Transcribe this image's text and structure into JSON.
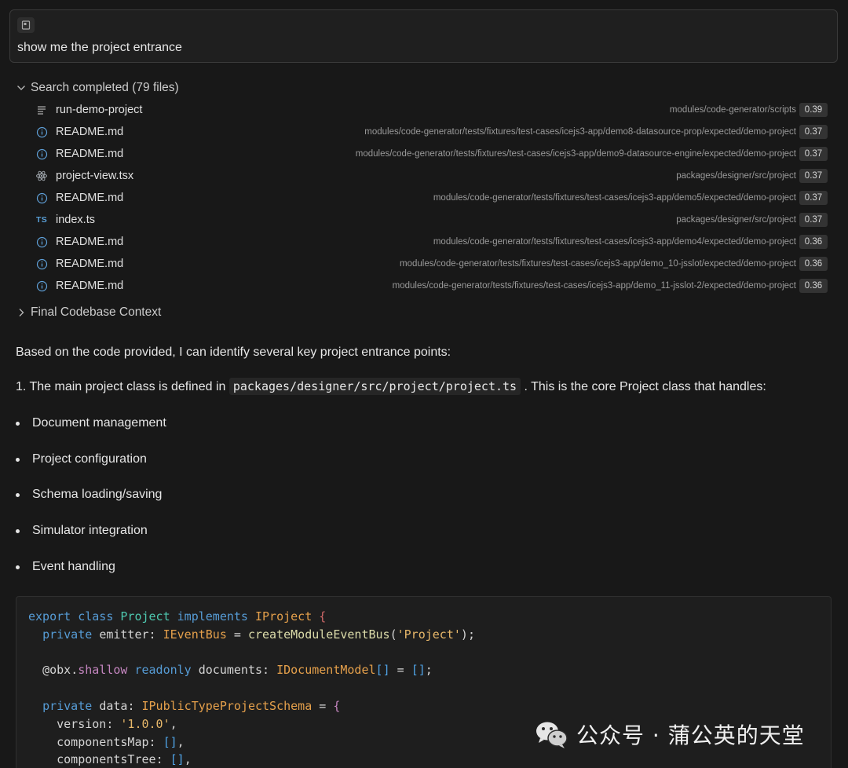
{
  "prompt": {
    "text": "show me the project entrance"
  },
  "search": {
    "header": "Search completed (79 files)",
    "results": [
      {
        "icon": "list-icon",
        "name": "run-demo-project",
        "path": "modules/code-generator/scripts",
        "score": "0.39"
      },
      {
        "icon": "info-icon",
        "name": "README.md",
        "path": "modules/code-generator/tests/fixtures/test-cases/icejs3-app/demo8-datasource-prop/expected/demo-project",
        "score": "0.37"
      },
      {
        "icon": "info-icon",
        "name": "README.md",
        "path": "modules/code-generator/tests/fixtures/test-cases/icejs3-app/demo9-datasource-engine/expected/demo-project",
        "score": "0.37"
      },
      {
        "icon": "react-icon",
        "name": "project-view.tsx",
        "path": "packages/designer/src/project",
        "score": "0.37"
      },
      {
        "icon": "info-icon",
        "name": "README.md",
        "path": "modules/code-generator/tests/fixtures/test-cases/icejs3-app/demo5/expected/demo-project",
        "score": "0.37"
      },
      {
        "icon": "ts-icon",
        "name": "index.ts",
        "path": "packages/designer/src/project",
        "score": "0.37"
      },
      {
        "icon": "info-icon",
        "name": "README.md",
        "path": "modules/code-generator/tests/fixtures/test-cases/icejs3-app/demo4/expected/demo-project",
        "score": "0.36"
      },
      {
        "icon": "info-icon",
        "name": "README.md",
        "path": "modules/code-generator/tests/fixtures/test-cases/icejs3-app/demo_10-jsslot/expected/demo-project",
        "score": "0.36"
      },
      {
        "icon": "info-icon",
        "name": "README.md",
        "path": "modules/code-generator/tests/fixtures/test-cases/icejs3-app/demo_11-jsslot-2/expected/demo-project",
        "score": "0.36"
      }
    ]
  },
  "context": {
    "header": "Final Codebase Context"
  },
  "answer": {
    "intro": "Based on the code provided, I can identify several key project entrance points:",
    "point1_prefix": "1. The main project class is defined in ",
    "point1_code": "packages/designer/src/project/project.ts",
    "point1_suffix": " . This is the core Project class that handles:",
    "bullets": [
      "Document management",
      "Project configuration",
      "Schema loading/saving",
      "Simulator integration",
      "Event handling"
    ]
  },
  "code": {
    "lines": [
      "export class Project implements IProject {",
      "  private emitter: IEventBus = createModuleEventBus('Project');",
      "",
      "  @obx.shallow readonly documents: IDocumentModel[] = [];",
      "",
      "  private data: IPublicTypeProjectSchema = {",
      "    version: '1.0.0',",
      "    componentsMap: [],",
      "    componentsTree: [],"
    ]
  },
  "watermark": {
    "text": "公众号 · 蒲公英的天堂"
  }
}
